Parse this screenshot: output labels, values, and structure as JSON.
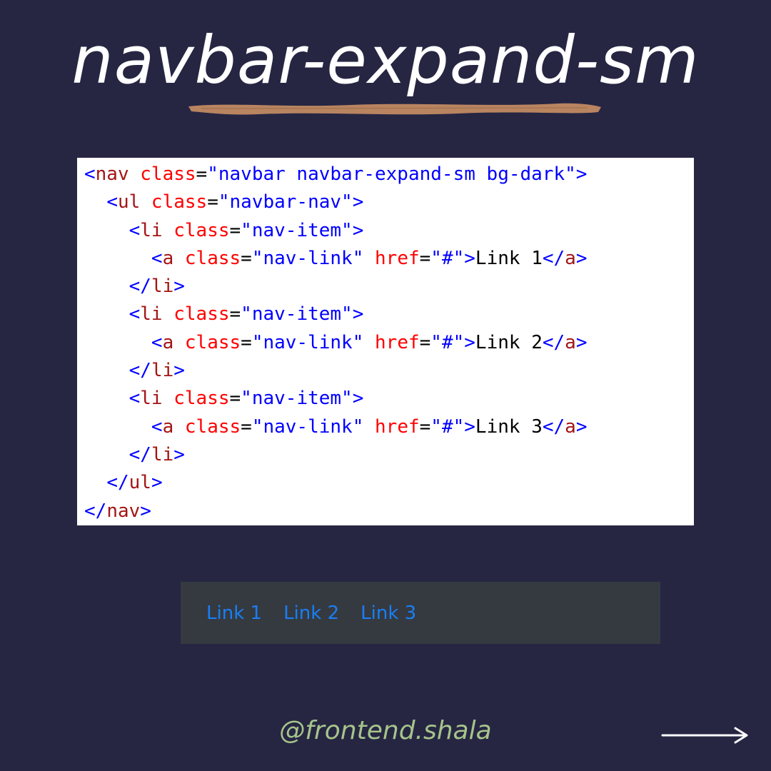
{
  "title": "navbar-expand-sm",
  "code": {
    "lines": [
      {
        "indent": "",
        "tokens": [
          {
            "t": "<",
            "c": "t-br"
          },
          {
            "t": "nav",
            "c": "t-tag"
          },
          {
            "t": " class",
            "c": "t-attr"
          },
          {
            "t": "=",
            "c": "t-eq"
          },
          {
            "t": "\"navbar navbar-expand-sm bg-dark\"",
            "c": "t-val"
          },
          {
            "t": ">",
            "c": "t-br"
          }
        ]
      },
      {
        "indent": "  ",
        "tokens": [
          {
            "t": "<",
            "c": "t-br"
          },
          {
            "t": "ul",
            "c": "t-tag"
          },
          {
            "t": " class",
            "c": "t-attr"
          },
          {
            "t": "=",
            "c": "t-eq"
          },
          {
            "t": "\"navbar-nav\"",
            "c": "t-val"
          },
          {
            "t": ">",
            "c": "t-br"
          }
        ]
      },
      {
        "indent": "    ",
        "tokens": [
          {
            "t": "<",
            "c": "t-br"
          },
          {
            "t": "li",
            "c": "t-tag"
          },
          {
            "t": " class",
            "c": "t-attr"
          },
          {
            "t": "=",
            "c": "t-eq"
          },
          {
            "t": "\"nav-item\"",
            "c": "t-val"
          },
          {
            "t": ">",
            "c": "t-br"
          }
        ]
      },
      {
        "indent": "      ",
        "tokens": [
          {
            "t": "<",
            "c": "t-br"
          },
          {
            "t": "a",
            "c": "t-tag"
          },
          {
            "t": " class",
            "c": "t-attr"
          },
          {
            "t": "=",
            "c": "t-eq"
          },
          {
            "t": "\"nav-link\"",
            "c": "t-val"
          },
          {
            "t": " href",
            "c": "t-attr"
          },
          {
            "t": "=",
            "c": "t-eq"
          },
          {
            "t": "\"#\"",
            "c": "t-val"
          },
          {
            "t": ">",
            "c": "t-br"
          },
          {
            "t": "Link 1",
            "c": "t-text"
          },
          {
            "t": "</",
            "c": "t-br"
          },
          {
            "t": "a",
            "c": "t-tag"
          },
          {
            "t": ">",
            "c": "t-br"
          }
        ]
      },
      {
        "indent": "    ",
        "tokens": [
          {
            "t": "</",
            "c": "t-br"
          },
          {
            "t": "li",
            "c": "t-tag"
          },
          {
            "t": ">",
            "c": "t-br"
          }
        ]
      },
      {
        "indent": "    ",
        "tokens": [
          {
            "t": "<",
            "c": "t-br"
          },
          {
            "t": "li",
            "c": "t-tag"
          },
          {
            "t": " class",
            "c": "t-attr"
          },
          {
            "t": "=",
            "c": "t-eq"
          },
          {
            "t": "\"nav-item\"",
            "c": "t-val"
          },
          {
            "t": ">",
            "c": "t-br"
          }
        ]
      },
      {
        "indent": "      ",
        "tokens": [
          {
            "t": "<",
            "c": "t-br"
          },
          {
            "t": "a",
            "c": "t-tag"
          },
          {
            "t": " class",
            "c": "t-attr"
          },
          {
            "t": "=",
            "c": "t-eq"
          },
          {
            "t": "\"nav-link\"",
            "c": "t-val"
          },
          {
            "t": " href",
            "c": "t-attr"
          },
          {
            "t": "=",
            "c": "t-eq"
          },
          {
            "t": "\"#\"",
            "c": "t-val"
          },
          {
            "t": ">",
            "c": "t-br"
          },
          {
            "t": "Link 2",
            "c": "t-text"
          },
          {
            "t": "</",
            "c": "t-br"
          },
          {
            "t": "a",
            "c": "t-tag"
          },
          {
            "t": ">",
            "c": "t-br"
          }
        ]
      },
      {
        "indent": "    ",
        "tokens": [
          {
            "t": "</",
            "c": "t-br"
          },
          {
            "t": "li",
            "c": "t-tag"
          },
          {
            "t": ">",
            "c": "t-br"
          }
        ]
      },
      {
        "indent": "    ",
        "tokens": [
          {
            "t": "<",
            "c": "t-br"
          },
          {
            "t": "li",
            "c": "t-tag"
          },
          {
            "t": " class",
            "c": "t-attr"
          },
          {
            "t": "=",
            "c": "t-eq"
          },
          {
            "t": "\"nav-item\"",
            "c": "t-val"
          },
          {
            "t": ">",
            "c": "t-br"
          }
        ]
      },
      {
        "indent": "      ",
        "tokens": [
          {
            "t": "<",
            "c": "t-br"
          },
          {
            "t": "a",
            "c": "t-tag"
          },
          {
            "t": " class",
            "c": "t-attr"
          },
          {
            "t": "=",
            "c": "t-eq"
          },
          {
            "t": "\"nav-link\"",
            "c": "t-val"
          },
          {
            "t": " href",
            "c": "t-attr"
          },
          {
            "t": "=",
            "c": "t-eq"
          },
          {
            "t": "\"#\"",
            "c": "t-val"
          },
          {
            "t": ">",
            "c": "t-br"
          },
          {
            "t": "Link 3",
            "c": "t-text"
          },
          {
            "t": "</",
            "c": "t-br"
          },
          {
            "t": "a",
            "c": "t-tag"
          },
          {
            "t": ">",
            "c": "t-br"
          }
        ]
      },
      {
        "indent": "    ",
        "tokens": [
          {
            "t": "</",
            "c": "t-br"
          },
          {
            "t": "li",
            "c": "t-tag"
          },
          {
            "t": ">",
            "c": "t-br"
          }
        ]
      },
      {
        "indent": "  ",
        "tokens": [
          {
            "t": "</",
            "c": "t-br"
          },
          {
            "t": "ul",
            "c": "t-tag"
          },
          {
            "t": ">",
            "c": "t-br"
          }
        ]
      },
      {
        "indent": "",
        "tokens": [
          {
            "t": "</",
            "c": "t-br"
          },
          {
            "t": "nav",
            "c": "t-tag"
          },
          {
            "t": ">",
            "c": "t-br"
          }
        ]
      }
    ]
  },
  "demo_nav": {
    "links": [
      "Link 1",
      "Link 2",
      "Link 3"
    ]
  },
  "handle": "@frontend.shala",
  "colors": {
    "background": "#262643",
    "brush": "#b98460",
    "demo_nav_bg": "#343a40",
    "demo_link": "#1a7ef5",
    "handle": "#a6c48a"
  },
  "icons": {
    "next": "arrow-right-icon"
  }
}
